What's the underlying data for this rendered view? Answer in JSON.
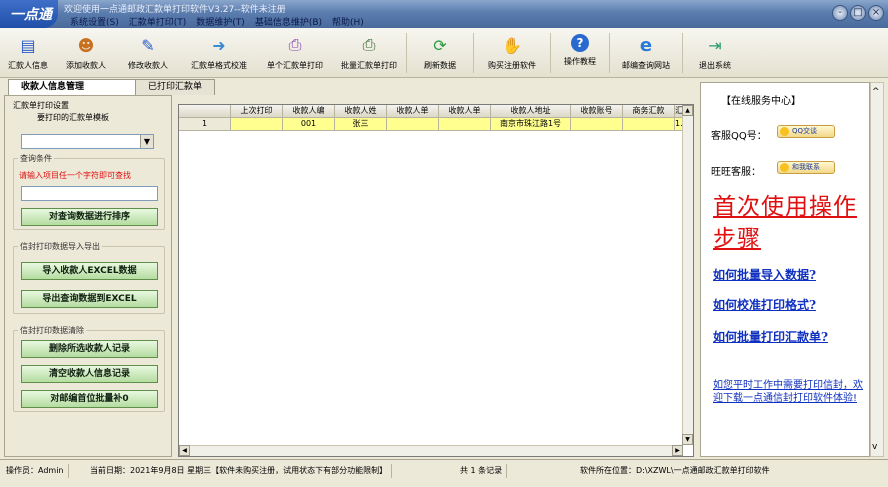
{
  "window": {
    "logo_text": "一点通",
    "title": "欢迎使用一点通邮政汇款单打印软件V3.27--软件未注册",
    "menu": [
      "系统设置(S)",
      "汇款单打印(T)",
      "数据维护(T)",
      "基础信息维护(B)",
      "帮助(H)"
    ],
    "win_buttons": [
      "-",
      "□",
      "×"
    ]
  },
  "toolbar": [
    {
      "label": "汇款人信息",
      "icon": "id-card-icon",
      "glyph": "▤"
    },
    {
      "label": "添加收款人",
      "icon": "add-person-icon",
      "glyph": "☻"
    },
    {
      "label": "修改收款人",
      "icon": "edit-person-icon",
      "glyph": "✎"
    },
    {
      "label": "汇款单格式校准",
      "icon": "calibrate-icon",
      "glyph": "➜"
    },
    {
      "label": "单个汇款单打印",
      "icon": "single-print-icon",
      "glyph": "⎙"
    },
    {
      "label": "批量汇款单打印",
      "icon": "batch-print-icon",
      "glyph": "⎙"
    },
    {
      "label": "刷新数据",
      "icon": "refresh-icon",
      "glyph": "⟳"
    },
    {
      "label": "购买注册软件",
      "icon": "buy-icon",
      "glyph": "✋"
    },
    {
      "label": "操作教程",
      "icon": "help-icon",
      "glyph": "?"
    },
    {
      "label": "邮编查询网站",
      "icon": "browser-icon",
      "glyph": "e"
    },
    {
      "label": "退出系统",
      "icon": "exit-icon",
      "glyph": "⇥"
    }
  ],
  "tabs": [
    "收款人信息管理",
    "已打印汇款单"
  ],
  "left": {
    "print_group_title": "汇款单打印设置",
    "template_label": "要打印的汇款单模板",
    "template_value": "",
    "query_group_title": "查询条件",
    "query_hint": "请输入项目任一个字符即可查找",
    "query_value": "",
    "sort_button": "对查询数据进行排序",
    "import_group_title": "信封打印数据导入导出",
    "import_button": "导入收款人EXCEL数据",
    "export_button": "导出查询数据到EXCEL",
    "clear_group_title": "信封打印数据清除",
    "delete_button": "删除所选收款人记录",
    "clear_button": "清空收款人信息记录",
    "fill_button": "对邮编首位批量补0"
  },
  "grid": {
    "columns": [
      "上次打印",
      "收款人编",
      "收款人姓",
      "收款人单",
      "收款人单",
      "收款人地址",
      "收款账号",
      "商务汇款",
      "汇"
    ],
    "rows": [
      {
        "num": "1",
        "cells": [
          "",
          "001",
          "张三",
          "",
          "",
          "南京市珠江路1号",
          "",
          "",
          "1."
        ]
      }
    ]
  },
  "right": {
    "title": "【在线服务中心】",
    "qq_label": "客服QQ号：",
    "qq_button": "QQ交谈",
    "ww_label": "旺旺客服：",
    "ww_button": "和我联系",
    "big_link": "首次使用操作步骤",
    "link1": "如何批量导入数据?",
    "link2": "如何校准打印格式?",
    "link3": "如何批量打印汇款单?",
    "small_link": "如您平时工作中需要打印信封，欢迎下载一点通信封打印软件体验!"
  },
  "status": {
    "operator": "操作员：Admin",
    "date": "当前日期：2021年9月8日 星期三【软件未购买注册，试用状态下有部分功能限制】",
    "count": "共 1 条记录",
    "location": "软件所在位置：D:\\XZWL\\一点通邮政汇款单打印软件"
  }
}
